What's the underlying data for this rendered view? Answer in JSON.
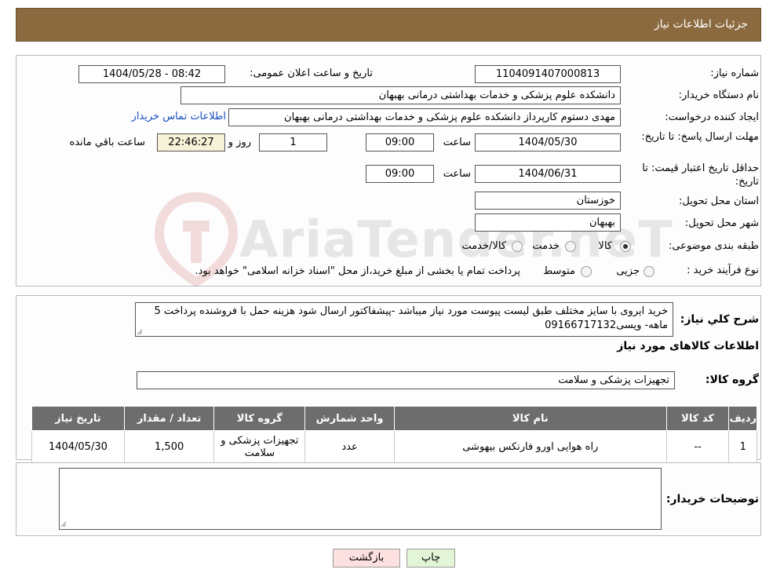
{
  "header": {
    "title": "جزئیات اطلاعات نیاز"
  },
  "form": {
    "need_number_label": "شماره نیاز:",
    "need_number": "1104091407000813",
    "announce_label": "تاریخ و ساعت اعلان عمومی:",
    "announce_value": "1404/05/28 - 08:42",
    "buyer_org_label": "نام دستگاه خریدار:",
    "buyer_org": "دانشکده علوم پزشکی و خدمات بهداشتی  درمانی بهبهان",
    "creator_label": "ایجاد کننده درخواست:",
    "creator": "مهدی دستوم کارپرداز دانشکده علوم پزشکی و خدمات بهداشتی  درمانی بهبهان",
    "contact_link": "اطلاعات تماس خریدار",
    "reply_deadline_label": "مهلت ارسال پاسخ: تا تاریخ:",
    "reply_date": "1404/05/30",
    "time_label": "ساعت",
    "reply_time": "09:00",
    "days_value": "1",
    "days_label": "روز و",
    "remaining_time": "22:46:27",
    "remaining_label": "ساعت باقي مانده",
    "price_validity_label": "حداقل تاریخ اعتبار قیمت: تا تاریخ:",
    "price_date": "1404/06/31",
    "price_time": "09:00",
    "province_label": "استان محل تحویل:",
    "province": "خوزستان",
    "city_label": "شهر محل تحویل:",
    "city": "بهبهان",
    "category_label": "طبقه بندی موضوعی:",
    "category_options": [
      "کالا",
      "خدمت",
      "کالا/خدمت"
    ],
    "process_label": "نوع فرآیند خرید :",
    "process_options": [
      "جزیی",
      "متوسط"
    ],
    "process_note": "پرداخت تمام یا بخشی از مبلغ خرید،از محل \"اسناد خزانه اسلامی\" خواهد بود."
  },
  "description": {
    "label": "شرح کلي نياز:",
    "text": "خرید ایروی با سایز مختلف طبق لیست پیوست  مورد نیاز میباشد -پیشفاکتور ارسال شود هزینه حمل با فروشنده پرداخت 5 ماهه- ویسی09166717132"
  },
  "goods": {
    "section_title": "اطلاعات کالاهای مورد نیاز",
    "group_label": "گروه کالا:",
    "group_value": "تجهیزات پزشکی و سلامت",
    "columns": [
      "ردیف",
      "کد کالا",
      "نام کالا",
      "واحد شمارش",
      "گروه کالا",
      "تعداد / مقدار",
      "تاریخ نیاز"
    ],
    "rows": [
      {
        "row": "1",
        "code": "--",
        "name": "راه هوایی اورو فارنکس بیهوشی",
        "unit": "عدد",
        "group": "تجهیزات پزشکی و سلامت",
        "qty": "1,500",
        "date": "1404/05/30"
      }
    ]
  },
  "buyer_notes": {
    "label": "توضیحات خریدار:",
    "text": ""
  },
  "buttons": {
    "print": "چاپ",
    "back": "بازگشت"
  },
  "watermark": {
    "text": "AriaTender.neT"
  },
  "colors": {
    "header_bg": "#8b6a3f",
    "table_head_bg": "#6d6d6d",
    "shaded_field": "#f6f2d8",
    "link": "#1a4fbf"
  }
}
